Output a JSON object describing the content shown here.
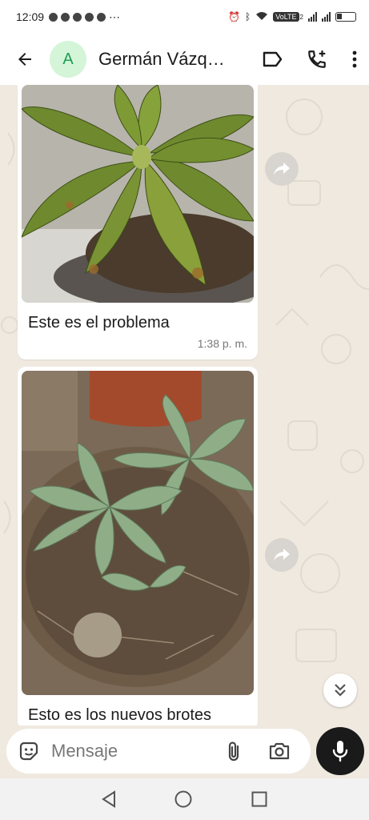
{
  "status_bar": {
    "time": "12:09",
    "volte": "VoLTE",
    "volte_sub": "2"
  },
  "header": {
    "avatar_letter": "A",
    "contact_name": "Germán Vázquez"
  },
  "messages": [
    {
      "caption": "Este es el problema",
      "time": "1:38 p. m."
    },
    {
      "caption": "Esto es los nuevos brotes",
      "time": ""
    }
  ],
  "composer": {
    "placeholder": "Mensaje"
  },
  "colors": {
    "accent": "#1f9d55",
    "avatar_bg": "#d4f5d8",
    "chat_bg": "#efe9e0",
    "mic_bg": "#1a1a1a"
  },
  "icons": {
    "back": "arrow-left-icon",
    "label": "label-icon",
    "call": "add-call-icon",
    "menu": "more-vert-icon",
    "forward": "forward-icon",
    "scroll": "double-chevron-down-icon",
    "sticker": "sticker-icon",
    "attach": "paperclip-icon",
    "camera": "camera-icon",
    "mic": "microphone-icon"
  }
}
